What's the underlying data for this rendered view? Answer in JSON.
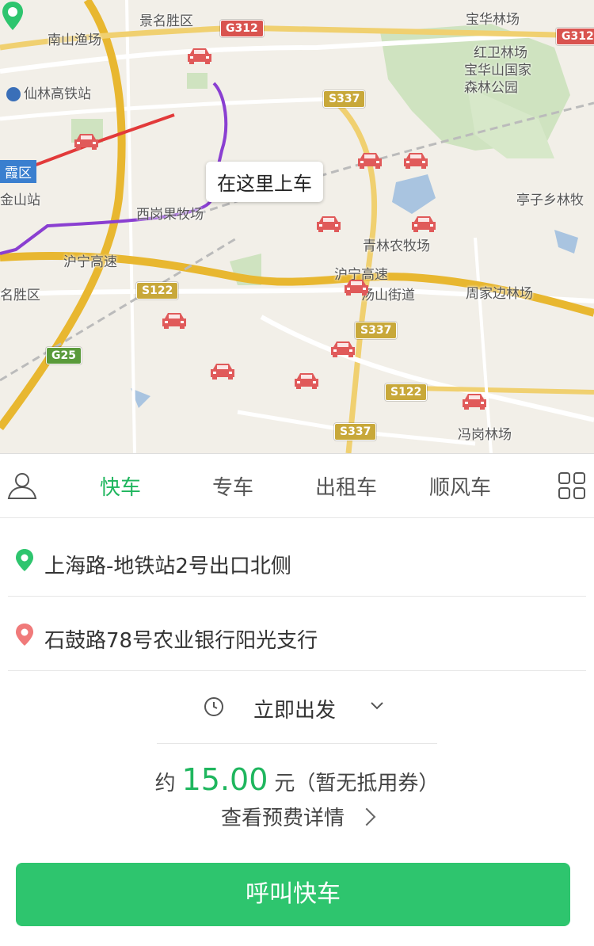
{
  "map": {
    "pickup_bubble": "在这里上车",
    "labels": [
      "南山渔场",
      "仙林高铁站",
      "霞区",
      "金山站",
      "西岗果牧场",
      "名胜区",
      "景名胜区",
      "宝华林场",
      "红卫林场",
      "宝华山国家",
      "森林公园",
      "亭子乡林牧",
      "青林农牧场",
      "汤山街道",
      "周家边林场",
      "冯岗林场",
      "沪宁高速",
      "沪宁高速"
    ],
    "shields": [
      "G312",
      "G312",
      "S337",
      "S122",
      "S337",
      "G25",
      "S122",
      "S337"
    ]
  },
  "tabs": [
    {
      "label": "快车",
      "active": true
    },
    {
      "label": "专车",
      "active": false
    },
    {
      "label": "出租车",
      "active": false
    },
    {
      "label": "顺风车",
      "active": false
    }
  ],
  "icons": {
    "user": "user-icon",
    "more": "grid-icon",
    "start": "green-pin-icon",
    "end": "red-pin-icon",
    "clock": "clock-icon",
    "chevron": "chevron-down-icon"
  },
  "route": {
    "start": "上海路-地铁站2号出口北侧",
    "end": "石鼓路78号农业银行阳光支行"
  },
  "departure": "立即出发",
  "fare": {
    "prefix": "约",
    "amount": "15.00",
    "suffix": "元（暂无抵用券）",
    "detail_link": "查看预费详情"
  },
  "call_button": "呼叫快车",
  "colors": {
    "accent": "#2ec56e",
    "active_tab": "#1fb65e",
    "car": "#e05a5a"
  }
}
